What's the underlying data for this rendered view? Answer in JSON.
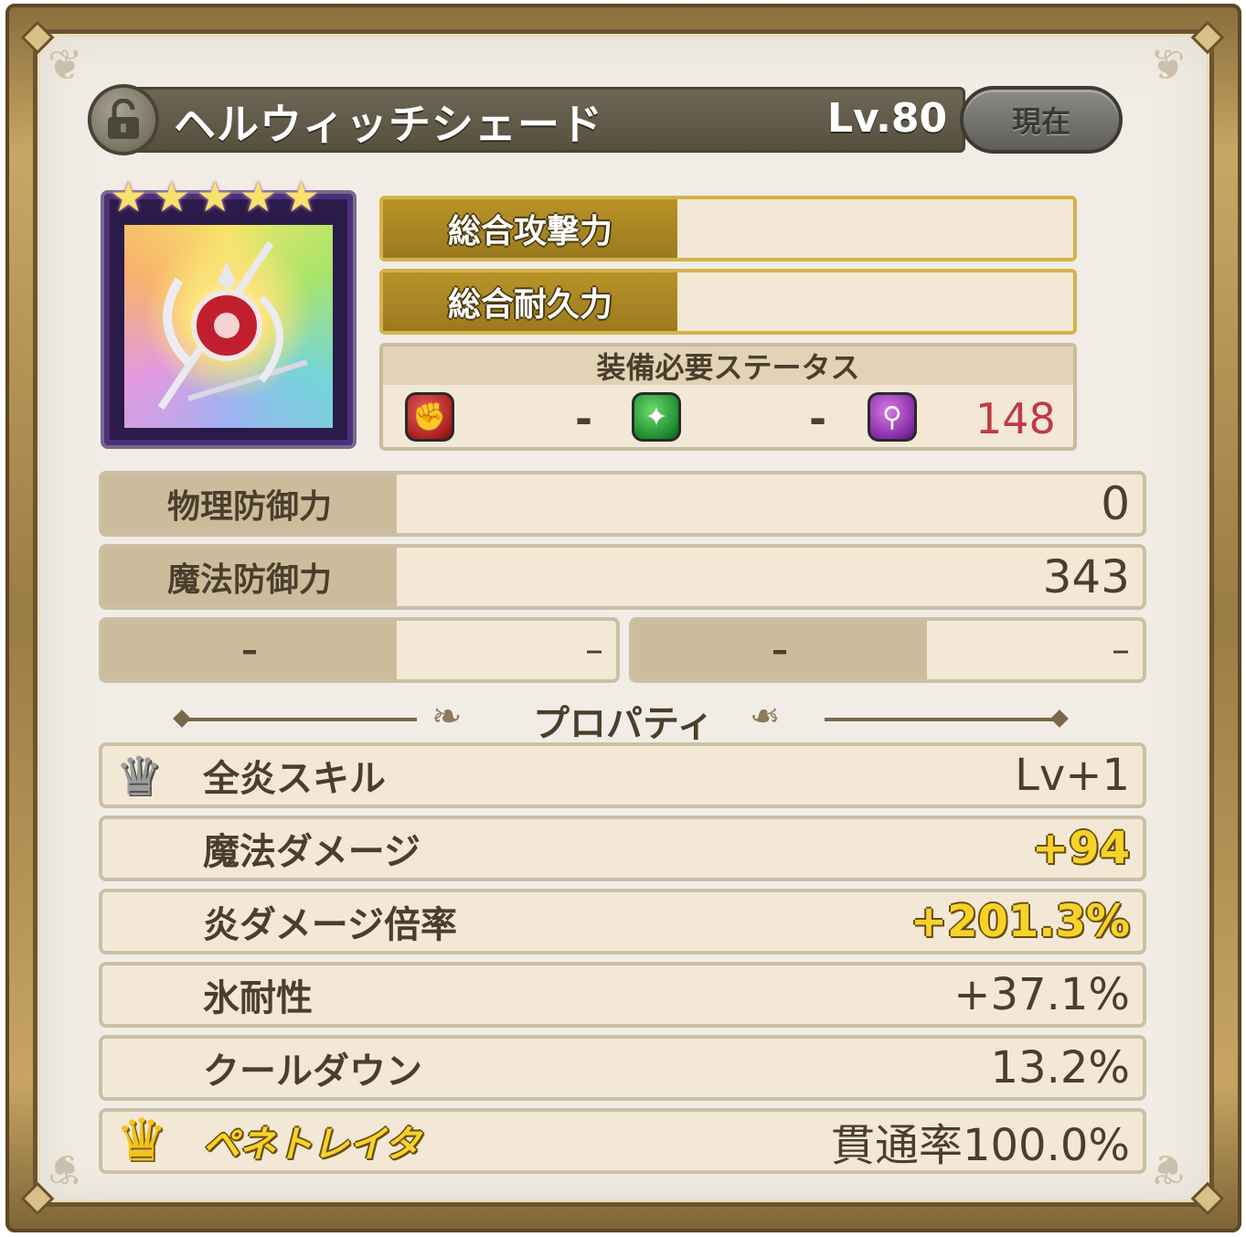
{
  "item": {
    "name": "ヘルウィッチシェード",
    "level": "Lv.80",
    "current_label": "現在",
    "rarity_stars": 5
  },
  "combined": {
    "attack_label": "総合攻撃力",
    "durability_label": "総合耐久力"
  },
  "requirements": {
    "title": "装備必要ステータス",
    "str_value": "-",
    "dex_value": "-",
    "int_value": "148"
  },
  "defense": {
    "physical_label": "物理防御力",
    "physical_value": "0",
    "magic_label": "魔法防御力",
    "magic_value": "343",
    "empty1_label": "–",
    "empty1_value": "–",
    "empty2_label": "–",
    "empty2_value": "–"
  },
  "properties": {
    "title": "プロパティ",
    "rows": [
      {
        "label": "全炎スキル",
        "value": "Lv+1"
      },
      {
        "label": "魔法ダメージ",
        "value": "+94"
      },
      {
        "label": "炎ダメージ倍率",
        "value": "+201.3%"
      },
      {
        "label": "氷耐性",
        "value": "+37.1%"
      },
      {
        "label": "クールダウン",
        "value": "13.2%"
      },
      {
        "label": "ペネトレイタ",
        "value": "貫通率100.0%"
      }
    ]
  },
  "icons": {
    "lock": "unlocked-padlock-icon",
    "str": "fist-icon",
    "dex": "sparkle-icon",
    "int": "magic-wand-icon",
    "crown_silver": "silver-crown-icon",
    "crown_gold": "gold-crown-icon"
  }
}
